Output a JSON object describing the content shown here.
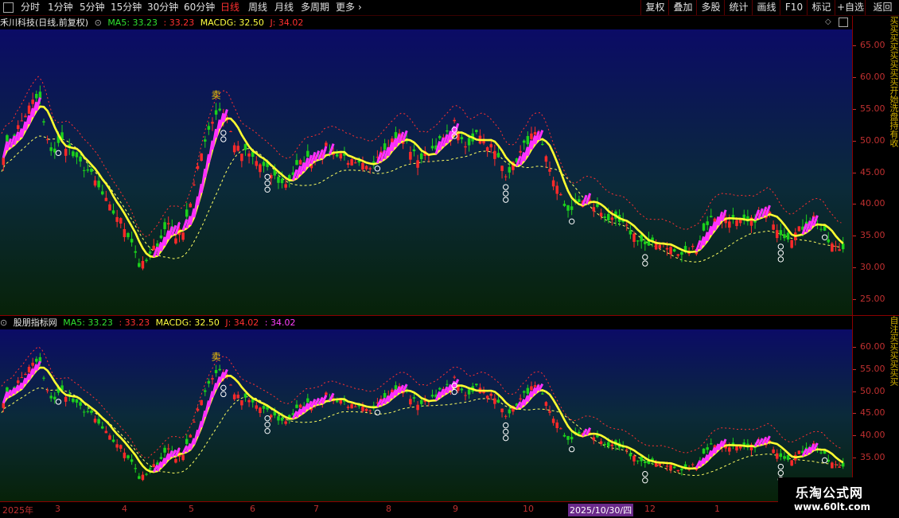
{
  "toolbar": {
    "periods": [
      "分时",
      "1分钟",
      "5分钟",
      "15分钟",
      "30分钟",
      "60分钟",
      "日线",
      "周线",
      "月线",
      "多周期",
      "更多"
    ],
    "active_period": "日线",
    "right_buttons": [
      "复权",
      "叠加",
      "多股",
      "统计",
      "画线",
      "F10",
      "标记",
      "+自选",
      "返回"
    ]
  },
  "panel1": {
    "title": "禾川科技(日线,前复权)",
    "ma5": "MA5: 33.23",
    "v1": ": 33.23",
    "macdg": "MACDG: 32.50",
    "j": "J: 34.02",
    "sell_marker": "卖",
    "axis_labels": [
      "65.00",
      "60.00",
      "55.00",
      "50.00",
      "45.00",
      "40.00",
      "35.00",
      "30.00",
      "25.00"
    ],
    "right_strip": "买买买买买买买买开始洗盘持有收"
  },
  "panel2": {
    "title": "股朋指标网",
    "ma5": "MA5: 33.23",
    "v1": ": 33.23",
    "macdg": "MACDG: 32.50",
    "j": "J: 34.02",
    "j2": ": 34.02",
    "sell_marker": "卖",
    "axis_labels": [
      "60.00",
      "55.00",
      "50.00",
      "45.00",
      "40.00",
      "35.00"
    ],
    "right_strip": "自注买买买买买买"
  },
  "dates": {
    "labels": [
      "2025年",
      "3",
      "4",
      "5",
      "6",
      "7",
      "8",
      "9",
      "10",
      "11",
      "12",
      "1"
    ],
    "cursor": "2025/10/30/四"
  },
  "watermark": {
    "name": "乐淘公式网",
    "url": "www.60lt.com"
  },
  "colors": {
    "up": "#ff2a2a",
    "down": "#1cd11c",
    "ma5": "#ffff30",
    "j": "#ff30ff",
    "macdg": "#ffffff",
    "accent": "#ff3030"
  },
  "chart_data": {
    "type": "candlestick",
    "y_range_panel1": [
      25,
      66
    ],
    "series": [
      {
        "name": "MA5",
        "values": [
          33.23
        ]
      },
      {
        "name": "MACDG",
        "values": [
          32.5
        ]
      },
      {
        "name": "J",
        "values": [
          34.02
        ]
      }
    ],
    "close_path": [
      48,
      50,
      52,
      54,
      56,
      57,
      50,
      48,
      50,
      49,
      47,
      46,
      45,
      43,
      41,
      39,
      38,
      36,
      34,
      30,
      31,
      33,
      35,
      37,
      35,
      36,
      40,
      45,
      50,
      53,
      55,
      54,
      50,
      48,
      48,
      47,
      46,
      45,
      44,
      43,
      44,
      46,
      47,
      47,
      48,
      49,
      48,
      48,
      47,
      46,
      46,
      45,
      48,
      49,
      50,
      51,
      50,
      48,
      47,
      48,
      49,
      50,
      51,
      53,
      49,
      49,
      52,
      50,
      49,
      47,
      45,
      46,
      48,
      50,
      51,
      49,
      46,
      43,
      40,
      39,
      40,
      41,
      40,
      39,
      38,
      37,
      37,
      36,
      35,
      34,
      33,
      34,
      34,
      33,
      32,
      32,
      33,
      34,
      37,
      38,
      38,
      38,
      37,
      37,
      37,
      38,
      39,
      38,
      36,
      35,
      35,
      36,
      37,
      38,
      36,
      34,
      33,
      33
    ]
  }
}
